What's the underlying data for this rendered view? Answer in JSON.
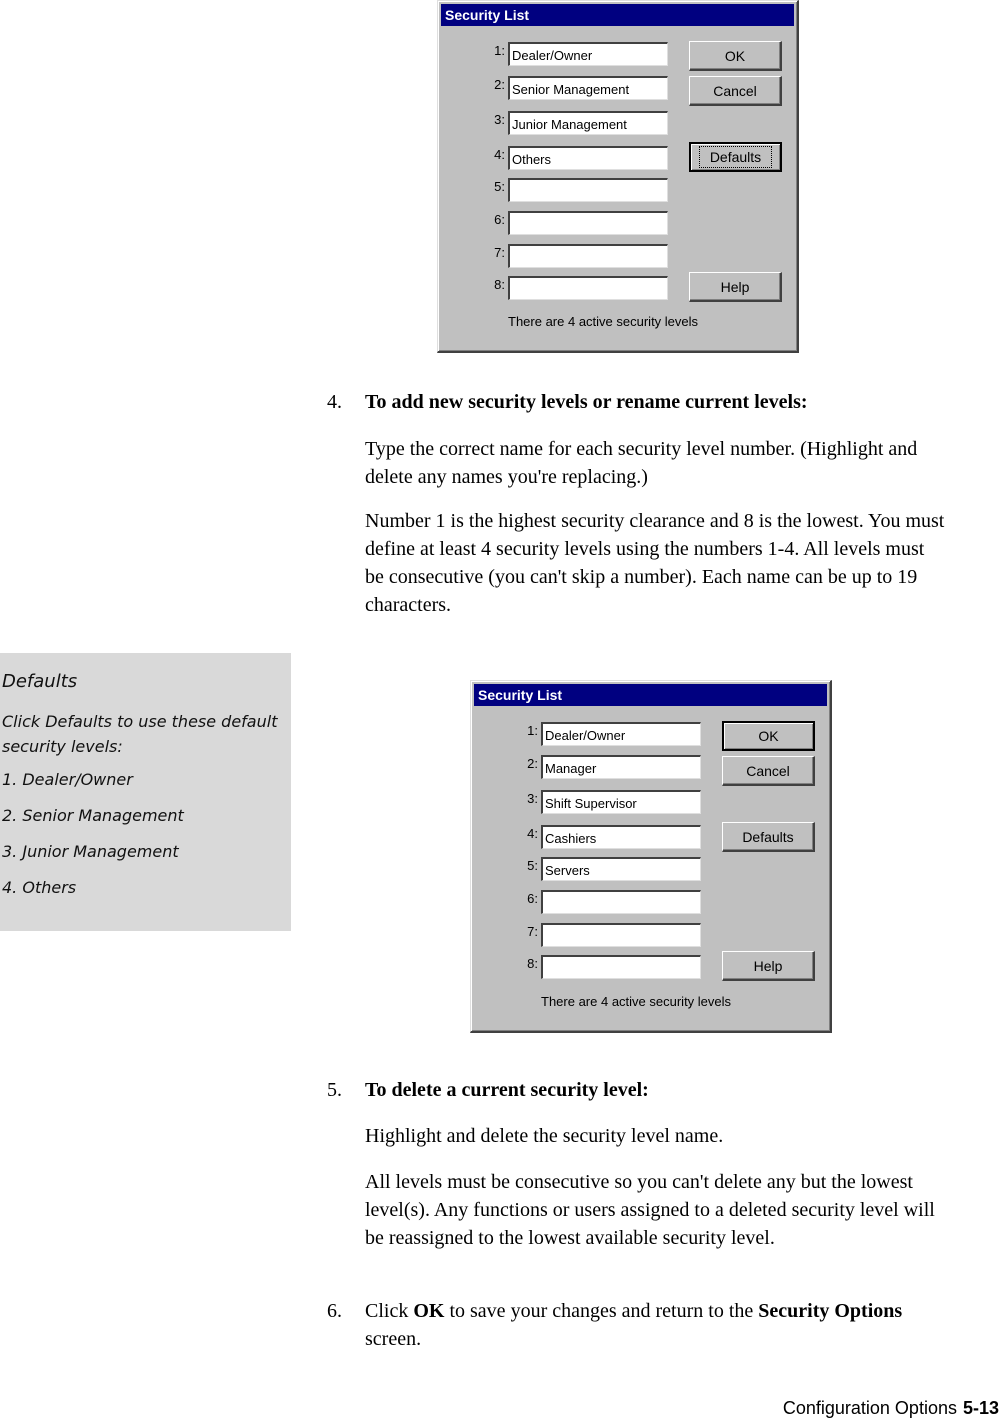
{
  "dialog1": {
    "title": "Security List",
    "rows": [
      {
        "num": "1:",
        "value": "Dealer/Owner"
      },
      {
        "num": "2:",
        "value": "Senior Management"
      },
      {
        "num": "3:",
        "value": "Junior Management"
      },
      {
        "num": "4:",
        "value": "Others"
      },
      {
        "num": "5:",
        "value": ""
      },
      {
        "num": "6:",
        "value": ""
      },
      {
        "num": "7:",
        "value": ""
      },
      {
        "num": "8:",
        "value": ""
      }
    ],
    "buttons": {
      "ok": "OK",
      "cancel": "Cancel",
      "defaults": "Defaults",
      "help": "Help"
    },
    "status": "There are 4 active security levels"
  },
  "step4": {
    "number": "4.",
    "heading": "To add new security levels or rename current levels:",
    "para1": "Type the correct name for each security level number. (Highlight and delete any names you're replacing.)",
    "para2": "Number 1 is the highest security clearance and 8 is the lowest. You must define at least 4 security levels using the numbers 1-4. All levels must be consecutive (you can't skip a number). Each name can be up to 19 characters."
  },
  "note": {
    "title": "Defaults",
    "body": "Click Defaults to use these default security levels:",
    "items": [
      "1.  Dealer/Owner",
      "2. Senior Management",
      "3. Junior Management",
      "4. Others"
    ]
  },
  "dialog2": {
    "title": "Security List",
    "rows": [
      {
        "num": "1:",
        "value": "Dealer/Owner"
      },
      {
        "num": "2:",
        "value": "Manager"
      },
      {
        "num": "3:",
        "value": "Shift Supervisor"
      },
      {
        "num": "4:",
        "value": "Cashiers"
      },
      {
        "num": "5:",
        "value": "Servers"
      },
      {
        "num": "6:",
        "value": ""
      },
      {
        "num": "7:",
        "value": ""
      },
      {
        "num": "8:",
        "value": ""
      }
    ],
    "buttons": {
      "ok": "OK",
      "cancel": "Cancel",
      "defaults": "Defaults",
      "help": "Help"
    },
    "status": "There are 4 active security levels"
  },
  "step5": {
    "number": "5.",
    "heading": "To delete a current security level:",
    "para1": "Highlight and delete the security level name.",
    "para2": "All levels must be consecutive so you can't delete any but the lowest level(s). Any functions or users assigned to a deleted security level will be reassigned to the lowest available security level."
  },
  "step6": {
    "number": "6.",
    "text_before": "Click ",
    "bold1": "OK",
    "text_mid": " to save your changes and return to the ",
    "bold2": "Security Options",
    "text_after": " screen."
  },
  "footer": {
    "section": "Configuration Options",
    "page": "5-13"
  }
}
